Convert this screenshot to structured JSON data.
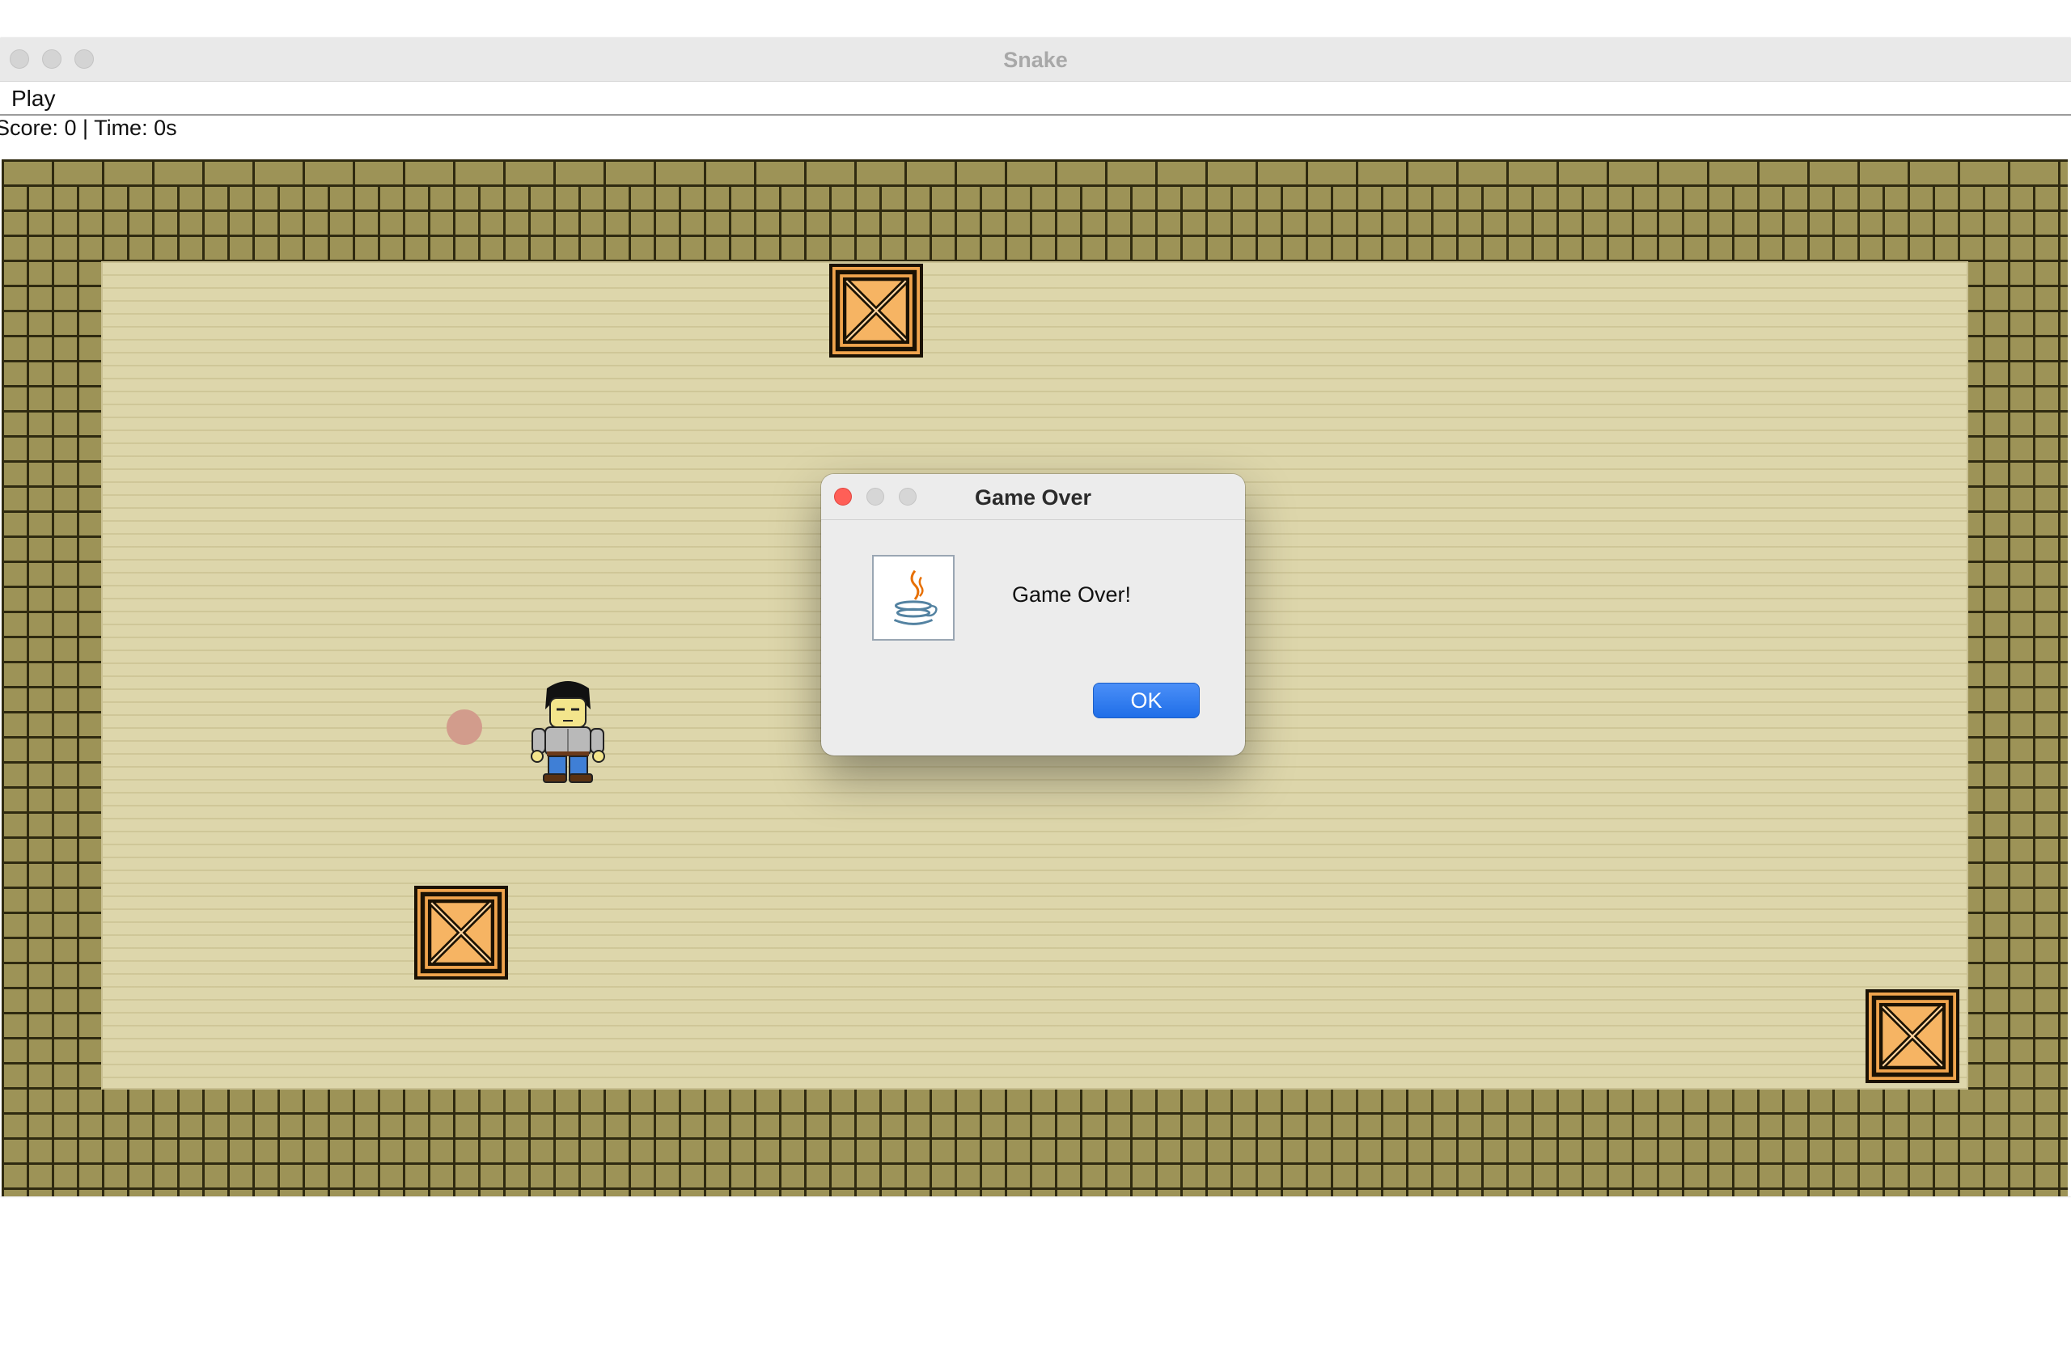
{
  "window": {
    "title": "Snake"
  },
  "menu": {
    "items": [
      {
        "label": "Play"
      }
    ]
  },
  "status": {
    "text": "Score: 0 | Time: 0s"
  },
  "game": {
    "objects": [
      {
        "type": "crate",
        "icon": "crate-icon"
      },
      {
        "type": "crate",
        "icon": "crate-icon"
      },
      {
        "type": "crate",
        "icon": "crate-icon"
      },
      {
        "type": "food",
        "color": "#d29c8c"
      },
      {
        "type": "player",
        "icon": "player-character"
      }
    ],
    "colors": {
      "sand": "#ddd6ab",
      "brick": "#9d9357",
      "mortar": "#2f2a10",
      "crate": "#f0a44d"
    }
  },
  "dialog": {
    "title": "Game Over",
    "message": "Game Over!",
    "ok_label": "OK",
    "icon": "java-icon"
  }
}
